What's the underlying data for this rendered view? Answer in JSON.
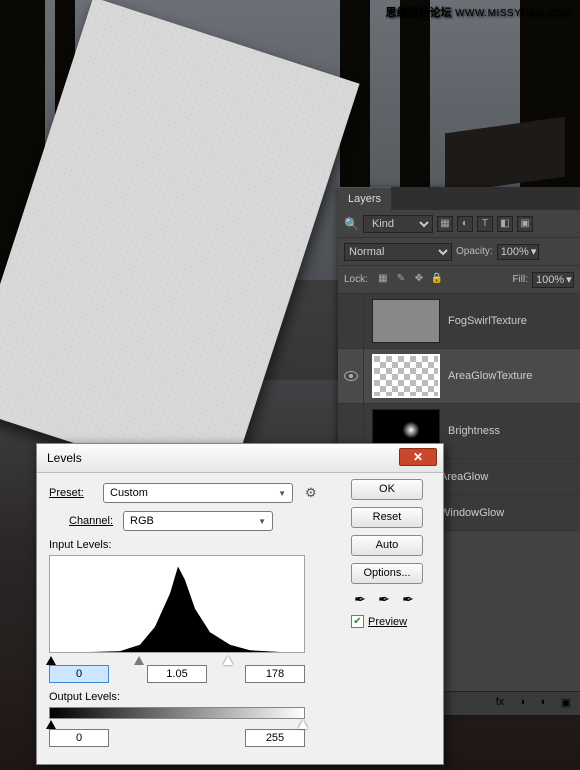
{
  "watermark": {
    "text": "思缘设计论坛",
    "url": "WWW.MISSYUAN.COM"
  },
  "layers_panel": {
    "tab": "Layers",
    "kind": "Kind",
    "blend_mode": "Normal",
    "opacity_label": "Opacity:",
    "opacity_value": "100%",
    "lock_label": "Lock:",
    "fill_label": "Fill:",
    "fill_value": "100%",
    "layers": [
      {
        "name": "FogSwirlTexture",
        "visible": false,
        "selected": false,
        "thumb": "gray"
      },
      {
        "name": "AreaGlowTexture",
        "visible": true,
        "selected": true,
        "thumb": "checker"
      },
      {
        "name": "Brightness",
        "visible": false,
        "selected": false,
        "thumb": "black"
      },
      {
        "name": "AreaGlow",
        "visible": false,
        "selected": false,
        "thumb": "none"
      },
      {
        "name": "WindowGlow",
        "visible": false,
        "selected": false,
        "thumb": "none"
      }
    ]
  },
  "levels_dialog": {
    "title": "Levels",
    "preset_label": "Preset:",
    "preset_value": "Custom",
    "channel_label": "Channel:",
    "channel_value": "RGB",
    "input_label": "Input Levels:",
    "input_shadow": "0",
    "input_mid": "1.05",
    "input_high": "178",
    "output_label": "Output Levels:",
    "output_shadow": "0",
    "output_high": "255",
    "buttons": {
      "ok": "OK",
      "reset": "Reset",
      "auto": "Auto",
      "options": "Options..."
    },
    "preview_label": "Preview",
    "preview_checked": true
  },
  "chart_data": {
    "type": "area",
    "title": "Input Levels histogram",
    "xlabel": "",
    "ylabel": "",
    "xlim": [
      0,
      255
    ],
    "ylim": [
      0,
      100
    ],
    "x": [
      0,
      40,
      70,
      90,
      105,
      120,
      128,
      135,
      145,
      160,
      180,
      200,
      230,
      255
    ],
    "values": [
      0,
      0,
      1,
      8,
      28,
      65,
      95,
      80,
      48,
      22,
      8,
      2,
      0,
      0
    ]
  }
}
